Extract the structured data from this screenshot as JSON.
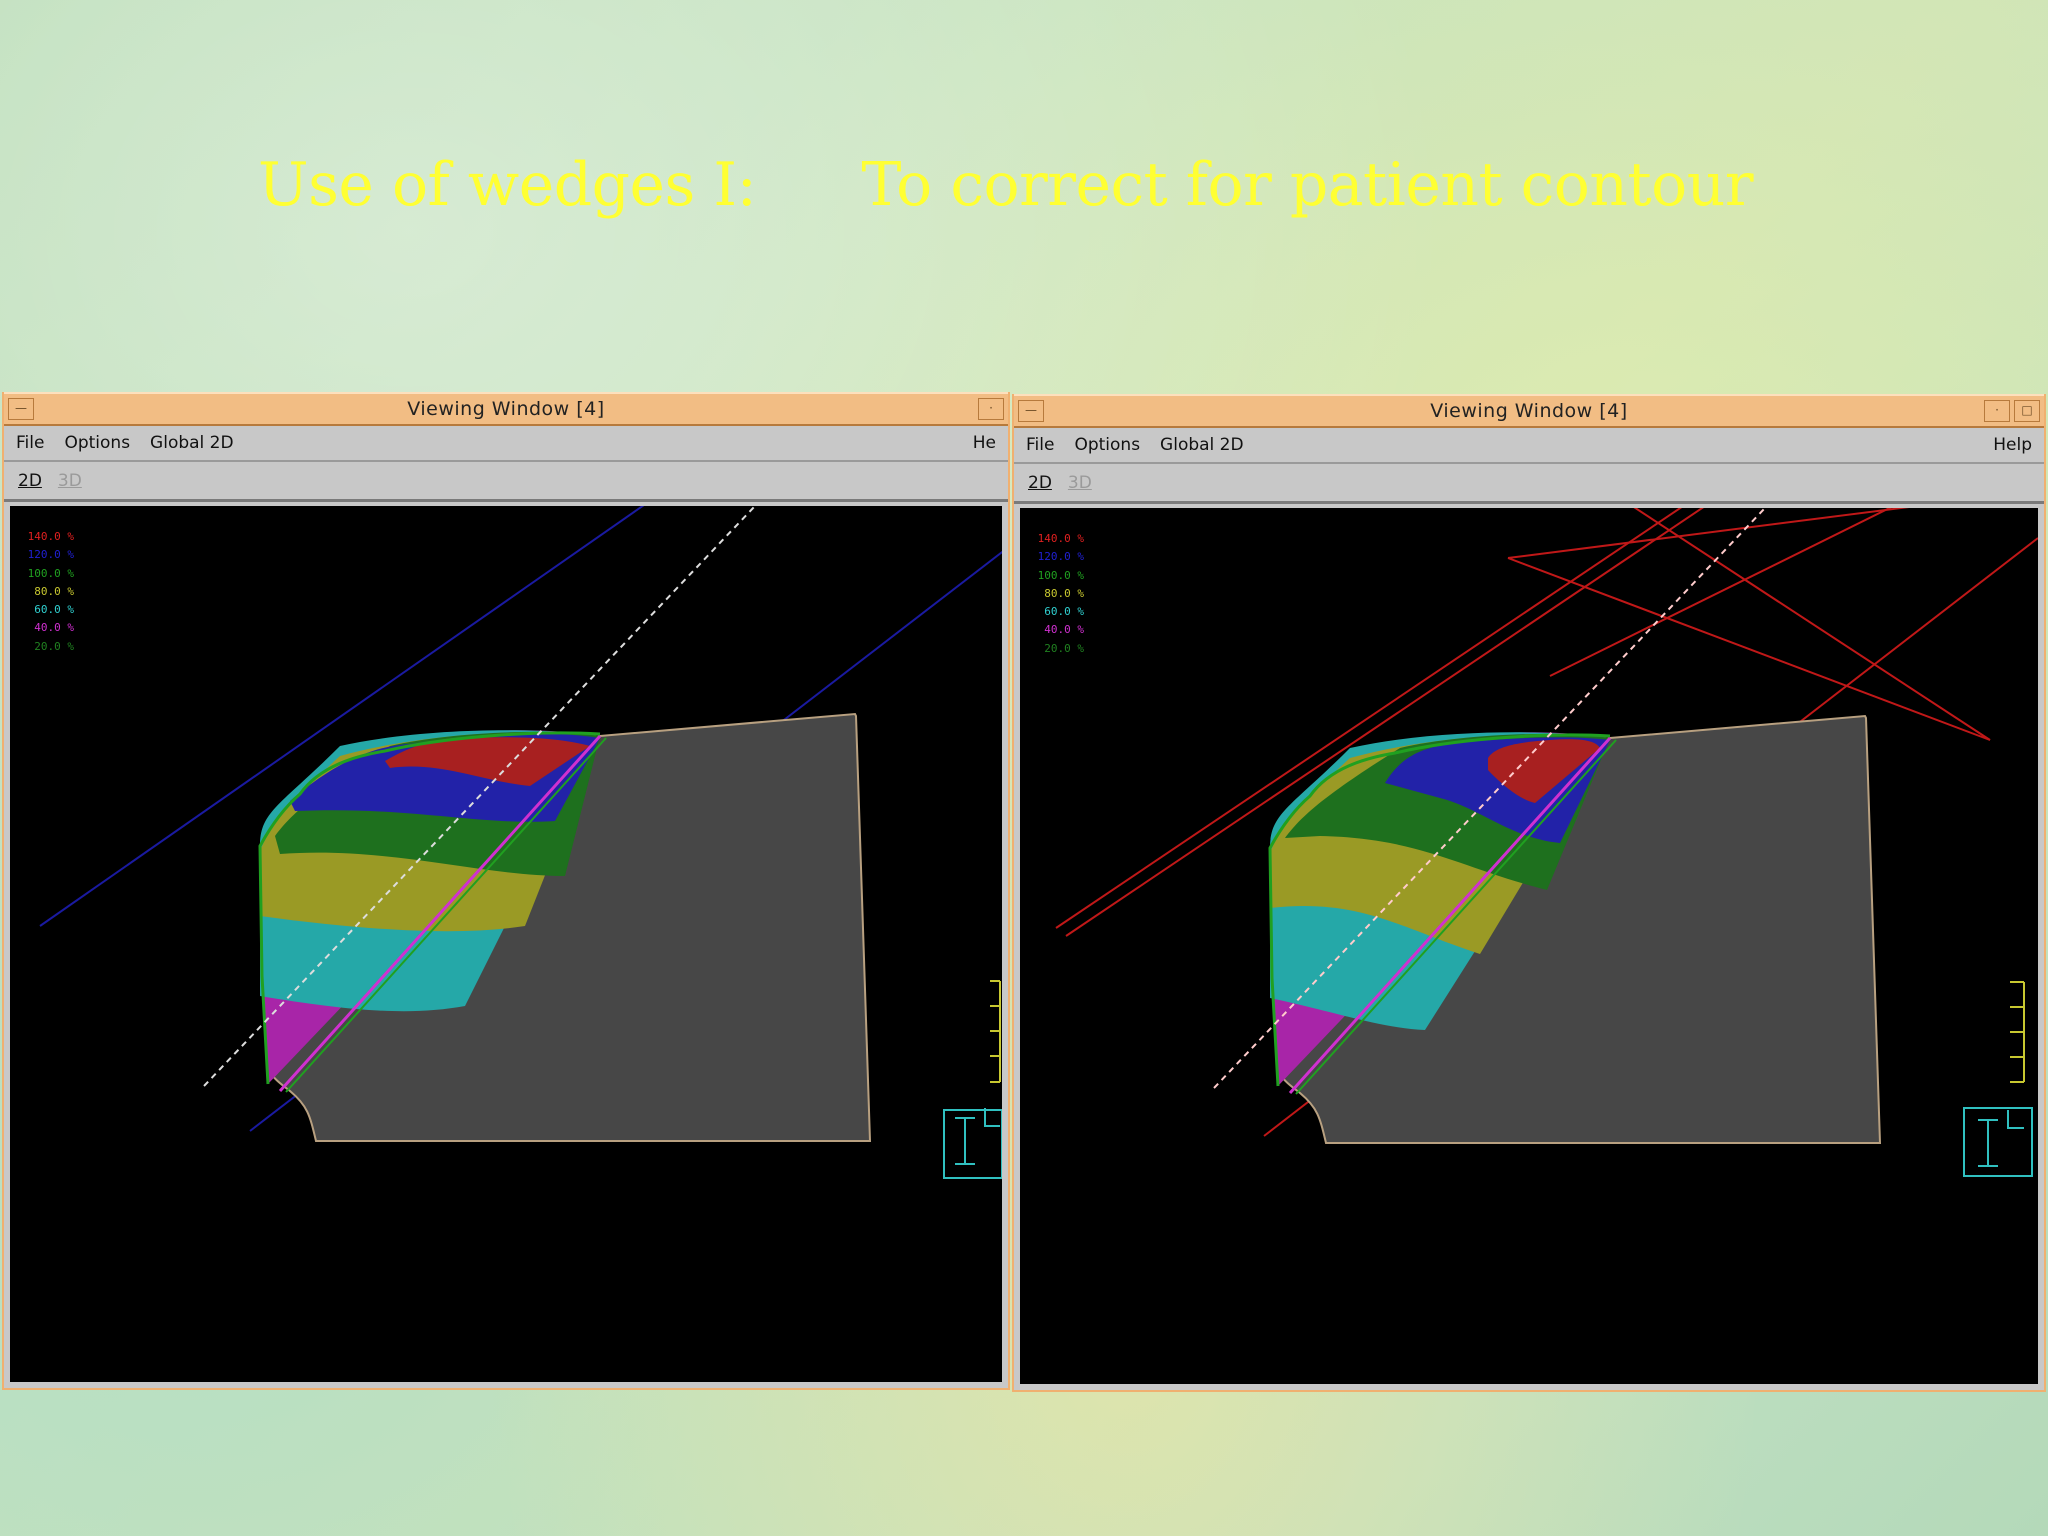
{
  "slide": {
    "title_part1": "Use of wedges I:",
    "title_part2": "To correct for patient contour"
  },
  "windows": [
    {
      "title": "Viewing Window [4]",
      "menu": {
        "file": "File",
        "options": "Options",
        "global2d": "Global 2D",
        "help": "He"
      },
      "toolbar": {
        "tab_2d": "2D",
        "tab_3d": "3D"
      }
    },
    {
      "title": "Viewing Window [4]",
      "menu": {
        "file": "File",
        "options": "Options",
        "global2d": "Global 2D",
        "help": "Help"
      },
      "toolbar": {
        "tab_2d": "2D",
        "tab_3d": "3D"
      }
    }
  ],
  "isodose_legend": [
    {
      "label": "140.0 %",
      "color": "#e02020"
    },
    {
      "label": "120.0 %",
      "color": "#2020d0"
    },
    {
      "label": "100.0 %",
      "color": "#20a020"
    },
    {
      "label": "80.0 %",
      "color": "#c8c830"
    },
    {
      "label": "60.0 %",
      "color": "#30d0d0"
    },
    {
      "label": "40.0 %",
      "color": "#d030d0"
    },
    {
      "label": "20.0 %",
      "color": "#208020"
    }
  ],
  "colors": {
    "titlebar": "#f2bd84",
    "title_text": "#ffff33",
    "patient_body": "#474747",
    "dose_140": "#a82020",
    "dose_120": "#2222a8",
    "dose_100": "#1e701e",
    "dose_80": "#9a9a25",
    "dose_60": "#25a8a8",
    "dose_40": "#a825a8",
    "beam_left": "#1a1aa0",
    "beam_right": "#c01818"
  },
  "icons": {
    "window_menu": "window-menu-icon",
    "minimize": "minimize-icon",
    "maximize": "maximize-icon",
    "orientation": "orientation-icon"
  }
}
